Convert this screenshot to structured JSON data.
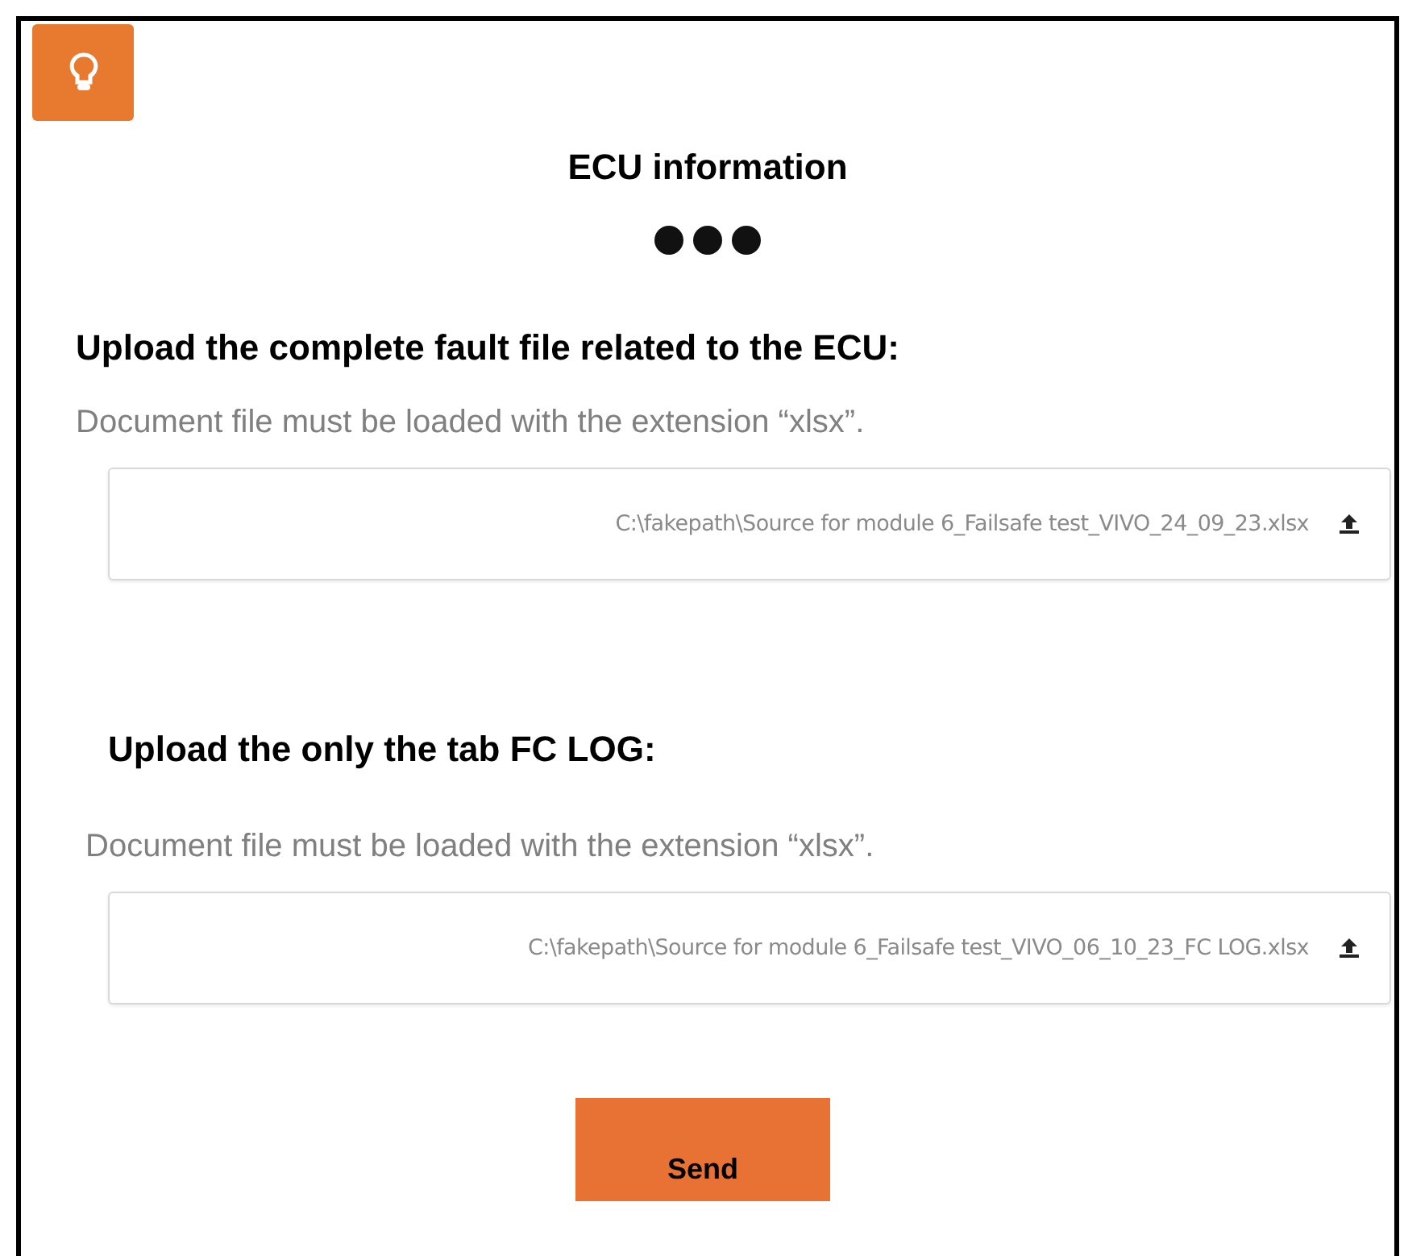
{
  "title": "ECU information",
  "uploads": [
    {
      "heading": "Upload the complete fault file related to the ECU:",
      "hint": "Document file must be loaded with the extension “xlsx”.",
      "value": "C:\\fakepath\\Source for module 6_Failsafe test_VIVO_24_09_23.xlsx"
    },
    {
      "heading": "Upload the only the tab FC LOG:",
      "hint": "Document file must be loaded with the extension “xlsx”.",
      "value": "C:\\fakepath\\Source for module 6_Failsafe test_VIVO_06_10_23_FC LOG.xlsx"
    }
  ],
  "send_button": "Send"
}
